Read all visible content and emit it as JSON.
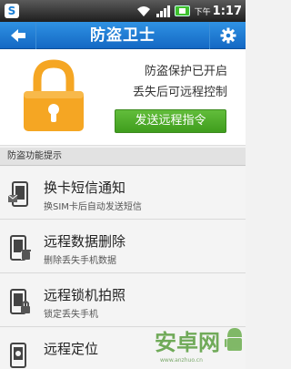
{
  "status_bar": {
    "am_pm": "下午",
    "time": "1:17"
  },
  "header": {
    "title": "防盗卫士"
  },
  "protection": {
    "status_line1": "防盗保护已开启",
    "status_line2": "丢失后可远程控制",
    "remote_button_label": "发送远程指令",
    "accent_color": "#4aa52a",
    "lock_color": "#f5a623"
  },
  "section": {
    "title": "防盗功能提示"
  },
  "features": [
    {
      "title": "换卡短信通知",
      "desc": "换SIM卡后自动发送短信",
      "icon": "sim-phone-icon"
    },
    {
      "title": "远程数据删除",
      "desc": "删除丢失手机数据",
      "icon": "phone-delete-icon"
    },
    {
      "title": "远程锁机拍照",
      "desc": "锁定丢失手机",
      "icon": "phone-lock-icon"
    },
    {
      "title": "远程定位",
      "desc": "",
      "icon": "phone-locate-icon"
    }
  ],
  "watermark": {
    "text": "安卓网",
    "url": "www.anzhuo.cn"
  }
}
